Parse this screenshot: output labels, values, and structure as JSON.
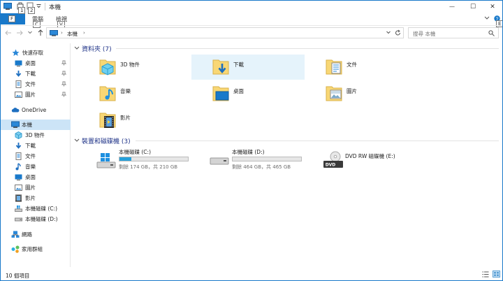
{
  "window": {
    "title": "本機",
    "minimize_symbol": "—",
    "maximize_symbol": "☐",
    "close_symbol": "✕"
  },
  "ribbon": {
    "file_tab": "F",
    "tabs": [
      "電腦",
      "檢視"
    ],
    "keytips": {
      "qat1": "1",
      "qat2": "2",
      "file": "F",
      "computer": "C",
      "view": "V",
      "help": "E"
    }
  },
  "address": {
    "path_root": "本機",
    "separator": "›",
    "search_placeholder": "搜尋 本機"
  },
  "nav": {
    "quick_access": "快速存取",
    "quick_items": [
      "桌面",
      "下載",
      "文件",
      "圖片"
    ],
    "onedrive": "OneDrive",
    "this_pc": "本機",
    "pc_items": [
      "3D 物件",
      "下載",
      "文件",
      "音樂",
      "桌面",
      "圖片",
      "影片",
      "本機磁碟 (C:)",
      "本機磁碟 (D:)"
    ],
    "network": "網路",
    "homegroup": "家用群組"
  },
  "folders_group": {
    "header": "資料夾 (7)",
    "items": [
      "3D 物件",
      "下載",
      "文件",
      "音樂",
      "桌面",
      "圖片",
      "影片"
    ]
  },
  "drives_group": {
    "header": "裝置和磁碟機 (3)",
    "items": [
      {
        "name": "本機磁碟 (C:)",
        "free_text": "剩餘 174 GB，共 210 GB",
        "used_fraction": 0.17
      },
      {
        "name": "本機磁碟 (D:)",
        "free_text": "剩餘 464 GB，共 465 GB",
        "used_fraction": 0.0
      },
      {
        "name": "DVD RW 磁碟機 (E:)",
        "disc_label": "DVD"
      }
    ]
  },
  "status": {
    "count_text": "10 個項目"
  },
  "colors": {
    "accent": "#1979ca",
    "folder": "#f8d775",
    "bar_fill": "#26a0da",
    "group_header": "#1e3287"
  }
}
